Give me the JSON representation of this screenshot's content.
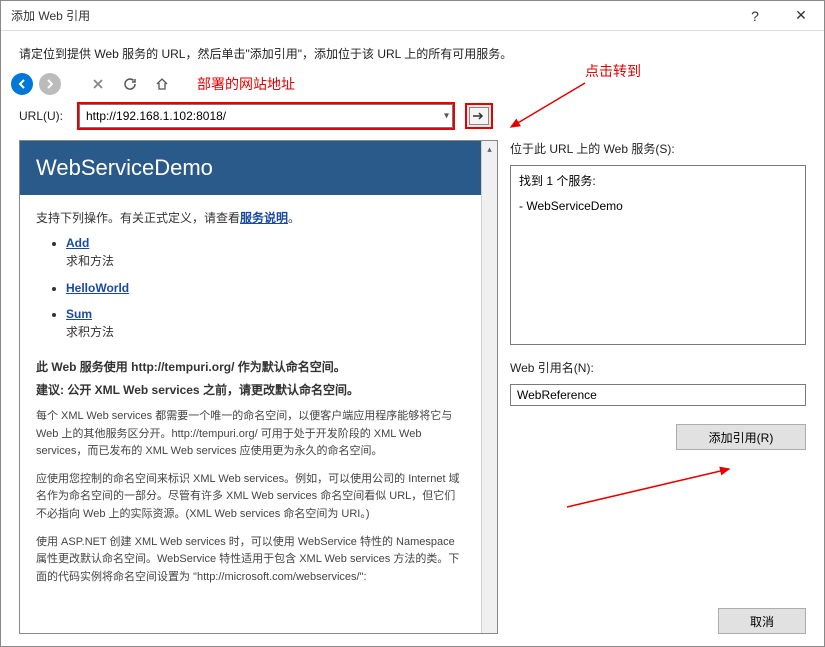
{
  "window": {
    "title": "添加 Web 引用",
    "help_icon": "?",
    "close_icon": "✕"
  },
  "instruction": "请定位到提供 Web 服务的 URL，然后单击\"添加引用\"，添加位于该 URL 上的所有可用服务。",
  "annotations": {
    "deployed_site": "部署的网站地址",
    "click_go": "点击转到"
  },
  "url_row": {
    "label": "URL(U):",
    "value": "http://192.168.1.102:8018/"
  },
  "webservice": {
    "title": "WebServiceDemo",
    "desc_prefix": "支持下列操作。有关正式定义，请查看",
    "desc_link": "服务说明",
    "desc_suffix": "。",
    "ops": [
      {
        "name": "Add",
        "desc": "求和方法"
      },
      {
        "name": "HelloWorld",
        "desc": ""
      },
      {
        "name": "Sum",
        "desc": "求积方法"
      }
    ],
    "ns_line": "此 Web 服务使用 http://tempuri.org/ 作为默认命名空间。",
    "note_line": "建议: 公开 XML Web services 之前，请更改默认命名空间。",
    "para1": "每个 XML Web services 都需要一个唯一的命名空间，以便客户端应用程序能够将它与 Web 上的其他服务区分开。http://tempuri.org/ 可用于处于开发阶段的 XML Web services，而已发布的 XML Web services 应使用更为永久的命名空间。",
    "para2": "应使用您控制的命名空间来标识 XML Web services。例如，可以使用公司的 Internet 域名作为命名空间的一部分。尽管有许多 XML Web services 命名空间看似 URL，但它们不必指向 Web 上的实际资源。(XML Web services 命名空间为 URI。)",
    "para3": "使用 ASP.NET 创建 XML Web services 时，可以使用 WebService 特性的 Namespace 属性更改默认命名空间。WebService 特性适用于包含 XML Web services 方法的类。下面的代码实例将命名空间设置为 \"http://microsoft.com/webservices/\":"
  },
  "right": {
    "services_label": "位于此 URL 上的 Web 服务(S):",
    "found_text": "找到 1 个服务:",
    "service_item": "- WebServiceDemo",
    "refname_label": "Web 引用名(N):",
    "refname_value": "WebReference",
    "add_btn": "添加引用(R)",
    "cancel_btn": "取消"
  }
}
